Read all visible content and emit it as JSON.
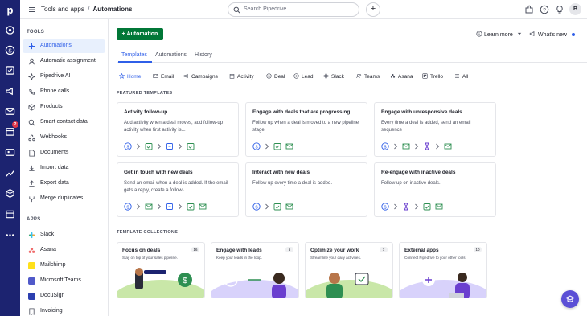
{
  "app": {
    "logo_letter": "p",
    "notification_count": "2",
    "avatar_initial": "B"
  },
  "topbar": {
    "breadcrumb_parent": "Tools and apps",
    "breadcrumb_separator": "/",
    "breadcrumb_current": "Automations",
    "search_placeholder": "Search Pipedrive",
    "add_label": "+"
  },
  "sidebar": {
    "tools_heading": "TOOLS",
    "tools": [
      {
        "label": "Automations",
        "icon": "automation-icon"
      },
      {
        "label": "Automatic assignment",
        "icon": "assignment-icon"
      },
      {
        "label": "Pipedrive AI",
        "icon": "ai-sparkle-icon"
      },
      {
        "label": "Phone calls",
        "icon": "phone-icon"
      },
      {
        "label": "Products",
        "icon": "box-icon"
      },
      {
        "label": "Smart contact data",
        "icon": "contact-data-icon"
      },
      {
        "label": "Webhooks",
        "icon": "webhook-icon"
      },
      {
        "label": "Documents",
        "icon": "document-icon"
      },
      {
        "label": "Import data",
        "icon": "import-icon"
      },
      {
        "label": "Export data",
        "icon": "export-icon"
      },
      {
        "label": "Merge duplicates",
        "icon": "merge-icon"
      }
    ],
    "apps_heading": "APPS",
    "apps": [
      {
        "label": "Slack",
        "color": "#e01e5a"
      },
      {
        "label": "Asana",
        "color": "#f06a6a"
      },
      {
        "label": "Mailchimp",
        "color": "#ffe01b"
      },
      {
        "label": "Microsoft Teams",
        "color": "#5059c9"
      },
      {
        "label": "DocuSign",
        "color": "#2c3fb0"
      },
      {
        "label": "Invoicing",
        "color": "#6a6e7c"
      }
    ]
  },
  "main": {
    "primary_button": "+ Automation",
    "learn_more": "Learn more",
    "whats_new": "What's new",
    "tabs": [
      "Templates",
      "Automations",
      "History"
    ],
    "filters": [
      "Home",
      "Email",
      "Campaigns",
      "Activity",
      "Deal",
      "Lead",
      "Slack",
      "Teams",
      "Asana",
      "Trello",
      "All"
    ],
    "featured_heading": "FEATURED TEMPLATES",
    "featured": [
      {
        "title": "Activity follow-up",
        "desc": "Add activity when a deal moves, add follow-up activity when first activity is..."
      },
      {
        "title": "Engage with deals that are progressing",
        "desc": "Follow up when a deal is moved to a new pipeline stage."
      },
      {
        "title": "Engage with unresponsive deals",
        "desc": "Every time a deal is added, send an email sequence"
      },
      {
        "title": "Get in touch with new deals",
        "desc": "Send an email when a deal is added. If the email gets a reply, create a follow-..."
      },
      {
        "title": "Interact with new deals",
        "desc": "Follow up every time a deal is added."
      },
      {
        "title": "Re-engage with inactive deals",
        "desc": "Follow up on inactive deals."
      }
    ],
    "collections_heading": "TEMPLATE COLLECTIONS",
    "collections": [
      {
        "title": "Focus on deals",
        "subtitle": "Stay on top of your sales pipeline.",
        "count": "16"
      },
      {
        "title": "Engage with leads",
        "subtitle": "Keep your leads in the loop.",
        "count": "6"
      },
      {
        "title": "Optimize your work",
        "subtitle": "Streamline your daily activities.",
        "count": "7"
      },
      {
        "title": "External apps",
        "subtitle": "Connect Pipedrive to your other tools.",
        "count": "10"
      }
    ]
  },
  "colors": {
    "rail": "#1c2370",
    "accent": "#2f5fe8",
    "primary_green": "#017737",
    "collection_art": "#c9e7a8",
    "collection_art_purple": "#d8d2fb"
  }
}
